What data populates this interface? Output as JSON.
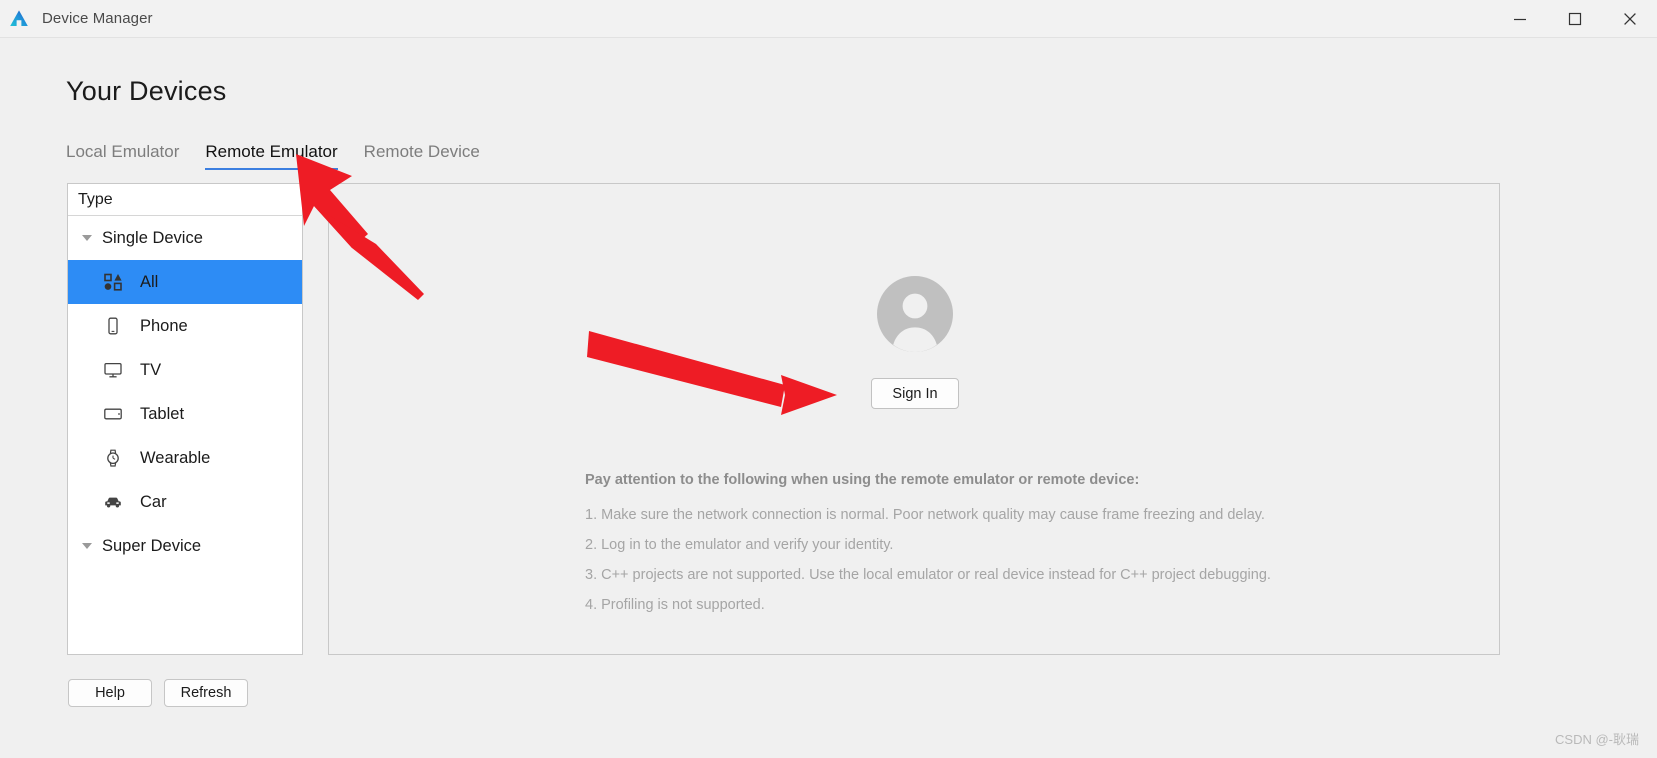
{
  "window": {
    "title": "Device Manager",
    "logo_icon": "deveco-logo-icon",
    "controls": {
      "minimize": "minimize-icon",
      "maximize": "maximize-icon",
      "close": "close-icon"
    }
  },
  "page": {
    "title": "Your Devices"
  },
  "tabs": [
    {
      "label": "Local Emulator",
      "active": false
    },
    {
      "label": "Remote Emulator",
      "active": true
    },
    {
      "label": "Remote Device",
      "active": false
    }
  ],
  "sidebar": {
    "header": "Type",
    "groups": [
      {
        "label": "Single Device",
        "expanded": true,
        "items": [
          {
            "label": "All",
            "icon": "shapes-grid-icon",
            "selected": true
          },
          {
            "label": "Phone",
            "icon": "phone-icon",
            "selected": false
          },
          {
            "label": "TV",
            "icon": "tv-icon",
            "selected": false
          },
          {
            "label": "Tablet",
            "icon": "tablet-icon",
            "selected": false
          },
          {
            "label": "Wearable",
            "icon": "watch-icon",
            "selected": false
          },
          {
            "label": "Car",
            "icon": "car-icon",
            "selected": false
          }
        ]
      },
      {
        "label": "Super Device",
        "expanded": true,
        "items": []
      }
    ]
  },
  "bottom_buttons": {
    "help": "Help",
    "refresh": "Refresh"
  },
  "main": {
    "avatar_icon": "user-avatar-icon",
    "sign_in_label": "Sign In",
    "notes_title": "Pay attention to the following when using the remote emulator or remote device:",
    "notes": [
      "1. Make sure the network connection is normal. Poor network quality may cause frame freezing and delay.",
      "2. Log in to the emulator and verify your identity.",
      "3. C++ projects are not supported. Use the local emulator or real device instead for C++ project debugging.",
      "4. Profiling is not supported."
    ]
  },
  "annotations": {
    "arrow_color": "#ee1c25",
    "arrow_tab_target": "Remote Emulator",
    "arrow_signin_target": "Sign In"
  },
  "watermark": "CSDN @-耿瑞"
}
